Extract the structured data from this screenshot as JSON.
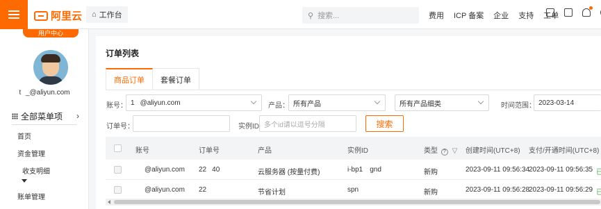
{
  "topbar": {
    "brand": "阿里云",
    "workbench_label": "工作台",
    "search_placeholder": "搜索...",
    "nav": [
      "费用",
      "ICP 备案",
      "企业",
      "支持",
      "工单"
    ],
    "icons": [
      "translate-icon",
      "terminal-icon",
      "bell-icon",
      "help-icon"
    ]
  },
  "sidebar": {
    "badge": "用户中心",
    "email": "t    _@aliyun.com",
    "all_menu": "全部菜单项",
    "items": [
      "首页",
      "资金管理",
      "收支明细",
      "账单管理"
    ]
  },
  "main": {
    "title": "订单列表",
    "tabs": [
      "商品订单",
      "套餐订单"
    ],
    "filters": {
      "account_label": "账号：",
      "account_value": "1    @aliyun.com",
      "product_label": "产品：",
      "product_value": "所有产品",
      "category_value": "所有产品细类",
      "time_label": "时间范围：",
      "time_value": "2023-03-14",
      "order_label": "订单号：",
      "instance_label": "实例ID",
      "instance_placeholder": "多个id请以逗号分隔",
      "search_button": "搜索"
    },
    "table": {
      "headers": [
        "账号",
        "订单号",
        "产品",
        "实例ID",
        "类型",
        "创建时间(UTC+8)",
        "支付/开通时间(UTC+8)"
      ],
      "rows": [
        {
          "account": "@aliyun.com",
          "order_no": "22    40",
          "product": "云服务器 (按量付费)",
          "instance": "i-bp1     gnd",
          "type": "新购",
          "created": "2023-09-11 09:56:34",
          "paid": "2023-09-11 09:56:35",
          "status": "已"
        },
        {
          "account": "@aliyun.com",
          "order_no": "22    ",
          "product": "节省计划",
          "instance": "spn    ",
          "type": "新购",
          "created": "2023-09-11 09:56:28",
          "paid": "2023-09-11 09:56:29",
          "status": "已"
        }
      ]
    }
  },
  "colors": {
    "accent": "#ff6a00",
    "success": "#4caf50"
  }
}
